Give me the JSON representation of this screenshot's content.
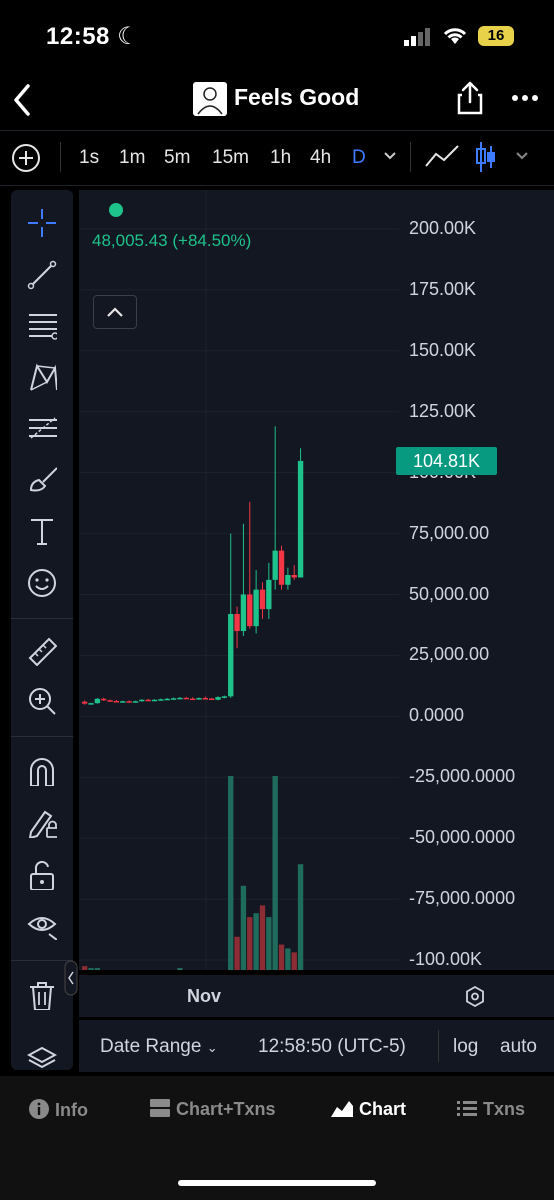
{
  "status": {
    "time": "12:58",
    "battery": "16"
  },
  "header": {
    "title": "Feels Good"
  },
  "toolbar": {
    "timeframes": [
      "1s",
      "1m",
      "5m",
      "15m",
      "1h",
      "4h",
      "D"
    ],
    "active": "D"
  },
  "legend": {
    "value": "48,005.43 (+84.50%)"
  },
  "bottom": {
    "date_range": "Date Range",
    "clock": "12:58:50 (UTC-5)",
    "log": "log",
    "auto": "auto"
  },
  "tabs": {
    "info": "Info",
    "chart_txns": "Chart+Txns",
    "chart": "Chart",
    "txns": "Txns"
  },
  "colors": {
    "up": "#1ec28b",
    "down": "#f23645",
    "accent": "#3f7bff",
    "badge": "#089981"
  },
  "chart_data": {
    "type": "candlestick",
    "x_label": "Nov",
    "y_ticks": [
      "200.00K",
      "175.00K",
      "150.00K",
      "125.00K",
      "100.00K",
      "75,000.00",
      "50,000.00",
      "25,000.00",
      "0.0000",
      "-25,000.0000",
      "-50,000.0000",
      "-75,000.0000",
      "-100.00K"
    ],
    "y_values": [
      200000,
      175000,
      150000,
      125000,
      100000,
      75000,
      50000,
      25000,
      0,
      -25000,
      -50000,
      -75000,
      -100000
    ],
    "ylim": [
      -100000,
      200000
    ],
    "last_price_label": "104.81K",
    "last_price": 104810,
    "candles": [
      {
        "o": 6000,
        "h": 6500,
        "l": 4800,
        "c": 5200
      },
      {
        "o": 5200,
        "h": 5600,
        "l": 4900,
        "c": 5400
      },
      {
        "o": 5400,
        "h": 7500,
        "l": 5200,
        "c": 7200
      },
      {
        "o": 7200,
        "h": 7600,
        "l": 6300,
        "c": 6600
      },
      {
        "o": 6600,
        "h": 6900,
        "l": 6000,
        "c": 6300
      },
      {
        "o": 6300,
        "h": 6700,
        "l": 5800,
        "c": 6000
      },
      {
        "o": 6000,
        "h": 6400,
        "l": 5700,
        "c": 6200
      },
      {
        "o": 6200,
        "h": 6500,
        "l": 5900,
        "c": 6000
      },
      {
        "o": 6000,
        "h": 6400,
        "l": 5800,
        "c": 6200
      },
      {
        "o": 6200,
        "h": 7000,
        "l": 6000,
        "c": 6800
      },
      {
        "o": 6800,
        "h": 7200,
        "l": 6400,
        "c": 6600
      },
      {
        "o": 6600,
        "h": 7000,
        "l": 6300,
        "c": 6800
      },
      {
        "o": 6800,
        "h": 7300,
        "l": 6500,
        "c": 7000
      },
      {
        "o": 7000,
        "h": 7500,
        "l": 6700,
        "c": 7200
      },
      {
        "o": 7200,
        "h": 7700,
        "l": 6800,
        "c": 7400
      },
      {
        "o": 7400,
        "h": 7900,
        "l": 7000,
        "c": 7600
      },
      {
        "o": 7600,
        "h": 8000,
        "l": 7100,
        "c": 7300
      },
      {
        "o": 7300,
        "h": 7800,
        "l": 6900,
        "c": 7100
      },
      {
        "o": 7100,
        "h": 7700,
        "l": 6800,
        "c": 7500
      },
      {
        "o": 7500,
        "h": 8100,
        "l": 7200,
        "c": 7300
      },
      {
        "o": 7300,
        "h": 7600,
        "l": 6700,
        "c": 6800
      },
      {
        "o": 6800,
        "h": 8200,
        "l": 6600,
        "c": 7900
      },
      {
        "o": 7900,
        "h": 8500,
        "l": 7400,
        "c": 8200
      },
      {
        "o": 8200,
        "h": 75000,
        "l": 7500,
        "c": 42000
      },
      {
        "o": 42000,
        "h": 45000,
        "l": 28000,
        "c": 35000
      },
      {
        "o": 35000,
        "h": 79000,
        "l": 33000,
        "c": 50000
      },
      {
        "o": 50000,
        "h": 88000,
        "l": 36000,
        "c": 37000
      },
      {
        "o": 37000,
        "h": 60000,
        "l": 34000,
        "c": 52000
      },
      {
        "o": 52000,
        "h": 55000,
        "l": 40000,
        "c": 44000
      },
      {
        "o": 44000,
        "h": 63000,
        "l": 40000,
        "c": 56000
      },
      {
        "o": 56000,
        "h": 119000,
        "l": 52000,
        "c": 68000
      },
      {
        "o": 68000,
        "h": 70000,
        "l": 52000,
        "c": 54000
      },
      {
        "o": 54000,
        "h": 61000,
        "l": 52000,
        "c": 58000
      },
      {
        "o": 58000,
        "h": 62000,
        "l": 56000,
        "c": 57000
      },
      {
        "o": 57000,
        "h": 110000,
        "l": 57000,
        "c": 104810
      }
    ],
    "volumes": [
      3,
      2,
      2,
      1,
      1,
      1,
      1,
      1,
      1,
      1,
      1,
      1,
      1,
      1,
      1,
      2,
      1,
      1,
      1,
      1,
      1,
      1,
      1,
      100,
      18,
      44,
      28,
      30,
      34,
      28,
      100,
      14,
      12,
      10,
      55
    ]
  }
}
